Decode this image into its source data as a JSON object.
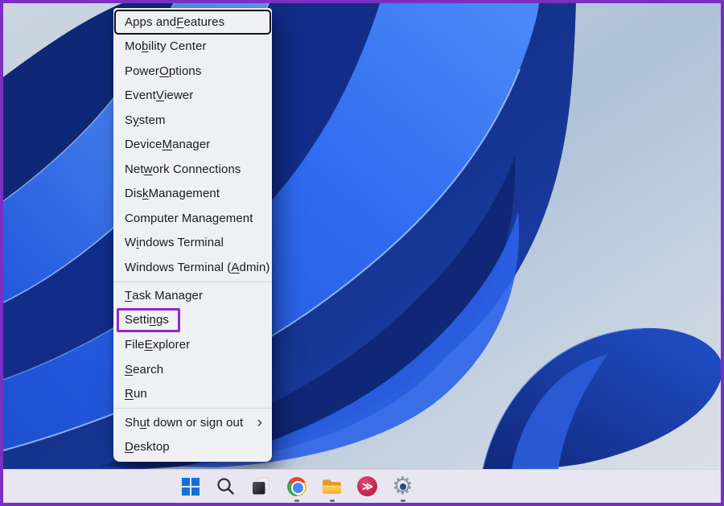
{
  "frame": {
    "border_color": "#7a2fc2",
    "description": "purple annotation frame around screenshot"
  },
  "annotation": {
    "highlight_color": "#9327c8",
    "highlighted_item": "Settings"
  },
  "menu": {
    "submenu_arrow": "›",
    "items": [
      {
        "pre": "Apps and ",
        "accel": "F",
        "post": "eatures",
        "state": "focused"
      },
      {
        "pre": "Mo",
        "accel": "b",
        "post": "ility Center"
      },
      {
        "pre": "Power ",
        "accel": "O",
        "post": "ptions"
      },
      {
        "pre": "Event ",
        "accel": "V",
        "post": "iewer"
      },
      {
        "pre": "S",
        "accel": "y",
        "post": "stem"
      },
      {
        "pre": "Device ",
        "accel": "M",
        "post": "anager"
      },
      {
        "pre": "Net",
        "accel": "w",
        "post": "ork Connections"
      },
      {
        "pre": "Dis",
        "accel": "k",
        "post": " Management"
      },
      {
        "pre": "Computer Mana",
        "accel": "g",
        "post": "ement"
      },
      {
        "pre": "W",
        "accel": "i",
        "post": "ndows Terminal"
      },
      {
        "pre": "Windows Terminal (",
        "accel": "A",
        "post": "dmin)"
      },
      {
        "type": "separator"
      },
      {
        "pre": "",
        "accel": "T",
        "post": "ask Manager"
      },
      {
        "pre": "Setti",
        "accel": "n",
        "post": "gs",
        "state": "highlighted"
      },
      {
        "pre": "File ",
        "accel": "E",
        "post": "xplorer"
      },
      {
        "pre": "",
        "accel": "S",
        "post": "earch"
      },
      {
        "pre": "",
        "accel": "R",
        "post": "un"
      },
      {
        "type": "separator"
      },
      {
        "pre": "Sh",
        "accel": "u",
        "post": "t down or sign out",
        "submenu": true
      },
      {
        "pre": "",
        "accel": "D",
        "post": "esktop"
      }
    ]
  },
  "taskbar": {
    "media_glyph": "≫",
    "settings_glyph": "⚙",
    "icons": [
      {
        "name": "start",
        "running": false
      },
      {
        "name": "search",
        "running": false
      },
      {
        "name": "task-view",
        "running": false
      },
      {
        "name": "chrome",
        "running": true
      },
      {
        "name": "file-explorer",
        "running": true
      },
      {
        "name": "media-app",
        "running": false
      },
      {
        "name": "settings",
        "running": true
      }
    ]
  },
  "wallpaper": {
    "name": "windows-11-bloom",
    "base_color": "#b2c5d9",
    "petal_bright": "#2f6bf0",
    "petal_dark": "#0f2876"
  }
}
